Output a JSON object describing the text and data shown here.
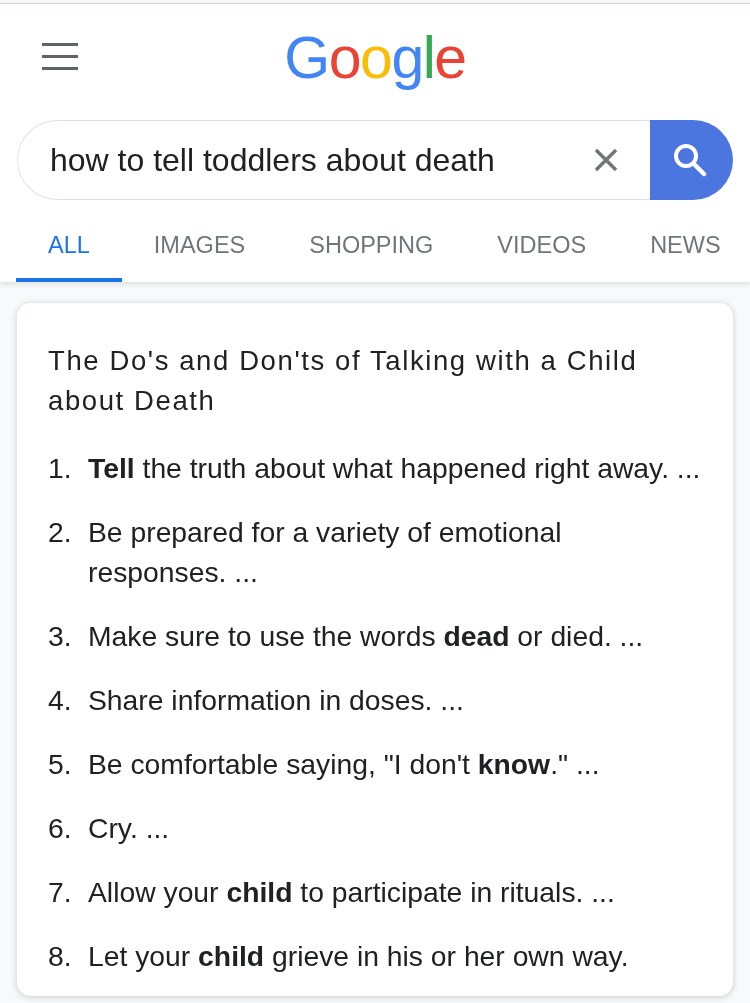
{
  "logo": "Google",
  "search": {
    "query": "how to tell toddlers about death"
  },
  "tabs": [
    {
      "label": "ALL",
      "selected": true
    },
    {
      "label": "IMAGES",
      "selected": false
    },
    {
      "label": "SHOPPING",
      "selected": false
    },
    {
      "label": "VIDEOS",
      "selected": false
    },
    {
      "label": "NEWS",
      "selected": false
    }
  ],
  "featured_snippet": {
    "title": "The Do's and Don'ts of Talking with a Child about Death",
    "items": [
      {
        "number": "1.",
        "text": "**Tell** the truth about what happened right away. ..."
      },
      {
        "number": "2.",
        "text": "Be prepared for a variety of emotional responses. ..."
      },
      {
        "number": "3.",
        "text": "Make sure to use the words **dead** or died. ..."
      },
      {
        "number": "4.",
        "text": "Share information in doses. ..."
      },
      {
        "number": "5.",
        "text": "Be comfortable saying, \"I don't **know**.\" ..."
      },
      {
        "number": "6.",
        "text": "Cry. ..."
      },
      {
        "number": "7.",
        "text": "Allow your **child** to participate in rituals. ..."
      },
      {
        "number": "8.",
        "text": "Let your **child** grieve in his or her own way."
      }
    ]
  }
}
